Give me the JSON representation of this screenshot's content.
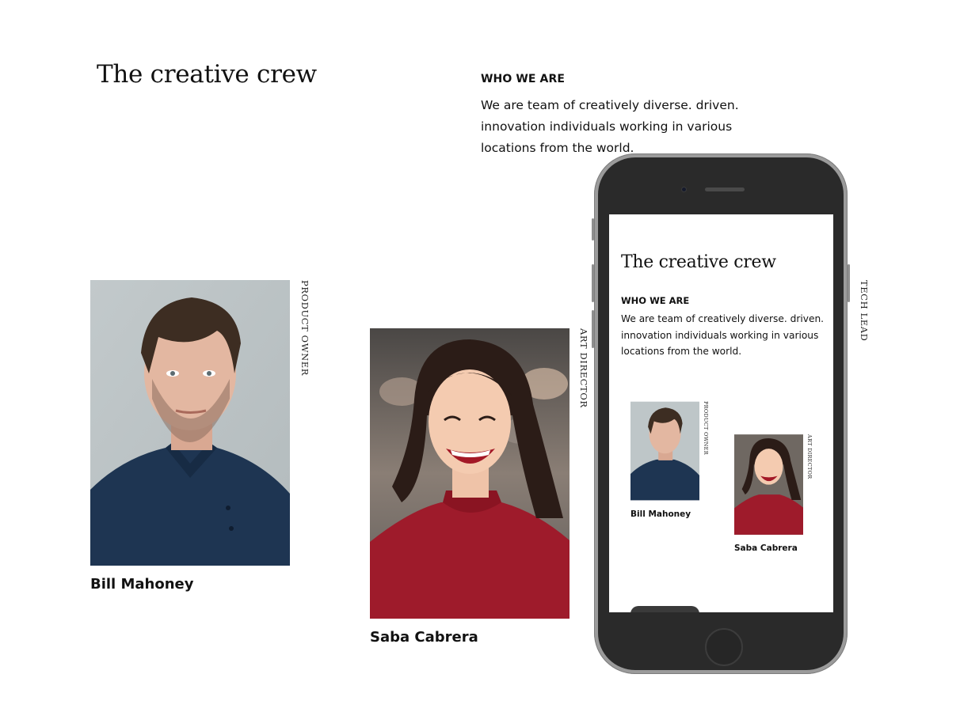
{
  "page": {
    "title": "The creative crew",
    "who_heading": "WHO WE ARE",
    "who_body": "We are team of creatively diverse. driven. innovation individuals working in various locations from the world."
  },
  "members": [
    {
      "name": "Bill Mahoney",
      "role": "PRODUCT OWNER",
      "photo": "portrait-man-navy-polo"
    },
    {
      "name": "Saba Cabrera",
      "role": "ART DIRECTOR",
      "photo": "portrait-woman-red-sweater"
    },
    {
      "role": "TECH LEAD"
    }
  ],
  "phone": {
    "title": "The creative crew",
    "who_heading": "WHO WE ARE",
    "who_body": "We are team of creatively diverse. driven. innovation individuals working in various locations from the world.",
    "members": [
      {
        "name": "Bill Mahoney",
        "role": "PRODUCT OWNER"
      },
      {
        "name": "Saba Cabrera",
        "role": "ART DIRECTOR"
      }
    ]
  },
  "colors": {
    "background": "#ffffff",
    "text": "#111111",
    "phone_frame": "#2a2a2a",
    "phone_bezel": "#9b9b9b",
    "sweater_red": "#9e1b2b",
    "polo_navy": "#1e3552"
  }
}
